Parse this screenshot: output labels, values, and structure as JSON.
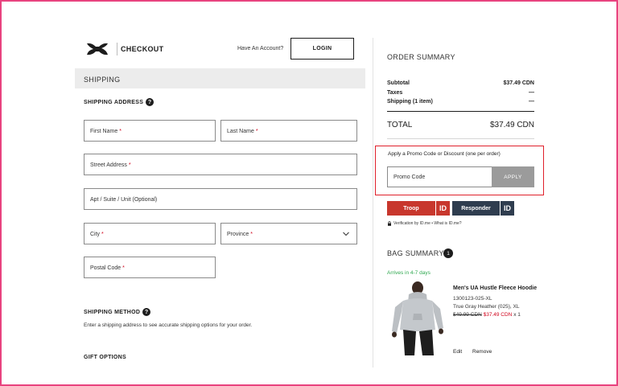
{
  "header": {
    "brand": "CHECKOUT",
    "account_prompt": "Have An Account?",
    "login_label": "LOGIN"
  },
  "shipping": {
    "section_label": "SHIPPING",
    "address_title": "SHIPPING ADDRESS",
    "help_glyph": "?",
    "required_mark": "*",
    "fields": {
      "first_name": "First Name",
      "last_name": "Last Name",
      "street": "Street Address",
      "apt": "Apt / Suite / Unit (Optional)",
      "city": "City",
      "province": "Province",
      "postal": "Postal Code"
    },
    "method_title": "SHIPPING METHOD",
    "method_hint": "Enter a shipping address to see accurate shipping options for your order.",
    "gift_title": "GIFT OPTIONS"
  },
  "order_summary": {
    "title": "ORDER SUMMARY",
    "rows": [
      {
        "label": "Subtotal",
        "value": "$37.49 CDN"
      },
      {
        "label": "Taxes",
        "value": "—"
      },
      {
        "label": "Shipping (1 item)",
        "value": "—"
      }
    ],
    "total_label": "TOTAL",
    "total_value": "$37.49 CDN"
  },
  "promo": {
    "hint": "Apply a Promo Code or Discount (one per order)",
    "placeholder": "Promo Code",
    "apply_label": "APPLY",
    "highlight_color": "#e0202b"
  },
  "id_me": {
    "troop_label": "Troop",
    "responder_label": "Responder",
    "id_label": "ID",
    "verification_text": "Verification by ID.me • What is ID.me?",
    "troop_color": "#c8372d",
    "responder_color": "#2f3d4f"
  },
  "bag": {
    "title": "BAG SUMMARY",
    "count": "1",
    "arrives": "Arrives in 4-7 days",
    "item": {
      "name": "Men's UA Hustle Fleece Hoodie",
      "sku": "1300123-025-XL",
      "variant": "True Gray Heather (025), XL",
      "original_price": "$49.99 CDN",
      "sale_price": "$37.49 CDN",
      "quantity": "x 1",
      "edit_label": "Edit",
      "remove_label": "Remove"
    }
  }
}
